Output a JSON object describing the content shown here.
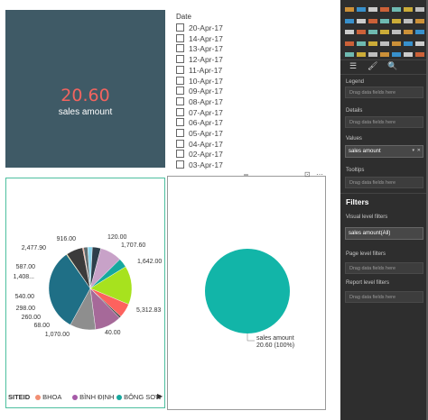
{
  "kpi": {
    "value": "20.60",
    "label": "sales amount"
  },
  "slicer": {
    "title": "Date",
    "dates": [
      "20-Apr-17",
      "14-Apr-17",
      "13-Apr-17",
      "12-Apr-17",
      "11-Apr-17",
      "10-Apr-17",
      "09-Apr-17",
      "08-Apr-17",
      "07-Apr-17",
      "06-Apr-17",
      "05-Apr-17",
      "04-Apr-17",
      "02-Apr-17",
      "03-Apr-17"
    ]
  },
  "pie_left": {
    "data_labels": [
      "916.00",
      "120.00",
      "1,707.60",
      "2,477.90",
      "1,642.00",
      "587.00",
      "1,408...",
      "540.00",
      "5,312.83",
      "298.00",
      "260.00",
      "68.00",
      "1,070.00",
      "40.00"
    ],
    "legend_title": "SITEID",
    "legend_items": [
      {
        "label": "BHOA",
        "color": "#f28f73"
      },
      {
        "label": "BÌNH ĐỊNH",
        "color": "#a65aa8"
      },
      {
        "label": "BÔNG SƠN",
        "color": "#16a89e"
      }
    ]
  },
  "pie_right": {
    "color": "#12b5a8",
    "label_line1": "sales amount",
    "label_line2": "20.60 (100%)"
  },
  "chart_data": [
    {
      "type": "pie",
      "title": "",
      "categories": [
        "BÔNG SƠN",
        "40.00",
        "1,070.00",
        "68.00",
        "260.00",
        "298.00",
        "540.00",
        "1,408...",
        "587.00",
        "2,477.90",
        "916.00",
        "120.00",
        "1,707.60",
        "1,642.00"
      ],
      "values": [
        5312.83,
        40,
        1070,
        68,
        260,
        298,
        540,
        1408,
        587,
        2477.9,
        916,
        120,
        1707.6,
        1642
      ],
      "legend": [
        "BHOA",
        "BÌNH ĐỊNH",
        "BÔNG SƠN"
      ]
    },
    {
      "type": "pie",
      "title": "",
      "categories": [
        "sales amount"
      ],
      "values": [
        20.6
      ]
    }
  ],
  "pane": {
    "sections": {
      "legend": "Legend",
      "details": "Details",
      "values": "Values",
      "tooltips": "Tooltips",
      "filters": "Filters",
      "visual_filters": "Visual level filters",
      "page_filters": "Page level filters",
      "report_filters": "Report level filters"
    },
    "drag_text": "Drag data fields here",
    "values_field": "sales amount",
    "visual_filter_field": "sales amount(All)"
  }
}
